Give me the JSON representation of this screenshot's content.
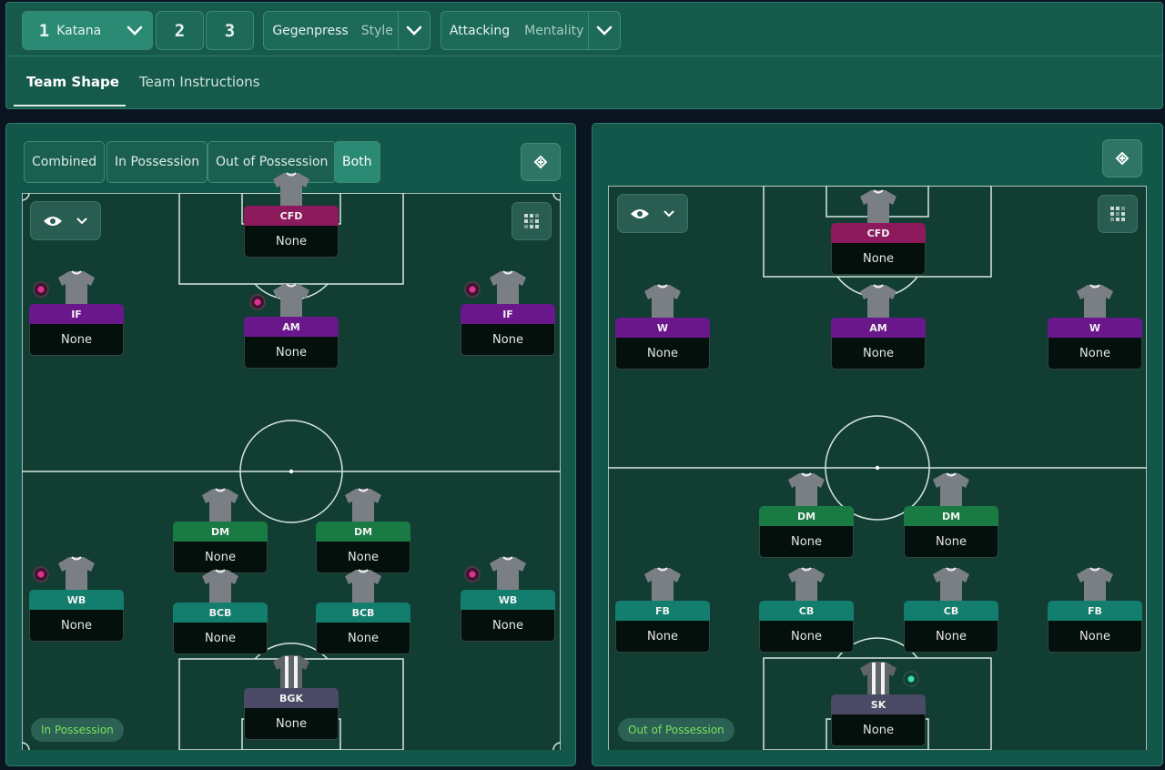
{
  "topbar": {
    "tactic_slots": [
      {
        "number": "1",
        "name": "Katana"
      },
      {
        "number": "2"
      },
      {
        "number": "3"
      }
    ],
    "style": {
      "value": "Gegenpress",
      "label": "Style"
    },
    "mentality": {
      "value": "Attacking",
      "label": "Mentality"
    },
    "tabs": [
      "Team Shape",
      "Team Instructions"
    ]
  },
  "left_panel": {
    "segments": [
      "Combined",
      "In Possession",
      "Out of Possession",
      "Both"
    ],
    "active_segment": "Both",
    "phase_label": "In Possession",
    "players": [
      {
        "role": "CFD",
        "assignment": "None",
        "color": "#8c1a5c"
      },
      {
        "role": "IF",
        "assignment": "None",
        "color": "#6a178c"
      },
      {
        "role": "AM",
        "assignment": "None",
        "color": "#6a178c"
      },
      {
        "role": "IF",
        "assignment": "None",
        "color": "#6a178c"
      },
      {
        "role": "DM",
        "assignment": "None",
        "color": "#1a7a44"
      },
      {
        "role": "DM",
        "assignment": "None",
        "color": "#1a7a44"
      },
      {
        "role": "WB",
        "assignment": "None",
        "color": "#137e6e"
      },
      {
        "role": "BCB",
        "assignment": "None",
        "color": "#137e6e"
      },
      {
        "role": "BCB",
        "assignment": "None",
        "color": "#137e6e"
      },
      {
        "role": "WB",
        "assignment": "None",
        "color": "#137e6e"
      },
      {
        "role": "BGK",
        "assignment": "None",
        "color": "#4a4a66"
      }
    ]
  },
  "right_panel": {
    "phase_label": "Out of Possession",
    "players": [
      {
        "role": "CFD",
        "assignment": "None",
        "color": "#8c1a5c"
      },
      {
        "role": "W",
        "assignment": "None",
        "color": "#6a178c"
      },
      {
        "role": "AM",
        "assignment": "None",
        "color": "#6a178c"
      },
      {
        "role": "W",
        "assignment": "None",
        "color": "#6a178c"
      },
      {
        "role": "DM",
        "assignment": "None",
        "color": "#1a7a44"
      },
      {
        "role": "DM",
        "assignment": "None",
        "color": "#1a7a44"
      },
      {
        "role": "FB",
        "assignment": "None",
        "color": "#137e6e"
      },
      {
        "role": "CB",
        "assignment": "None",
        "color": "#137e6e"
      },
      {
        "role": "CB",
        "assignment": "None",
        "color": "#137e6e"
      },
      {
        "role": "FB",
        "assignment": "None",
        "color": "#137e6e"
      },
      {
        "role": "SK",
        "assignment": "None",
        "color": "#4a4a66"
      }
    ]
  },
  "colors": {
    "accent": "#2a8a73",
    "phase_text": "#79e25a"
  },
  "icons": [
    "chevron-down-icon",
    "tactics-board-icon",
    "eye-icon",
    "grid-icon",
    "shirt-icon",
    "instruction-badge-icon"
  ]
}
